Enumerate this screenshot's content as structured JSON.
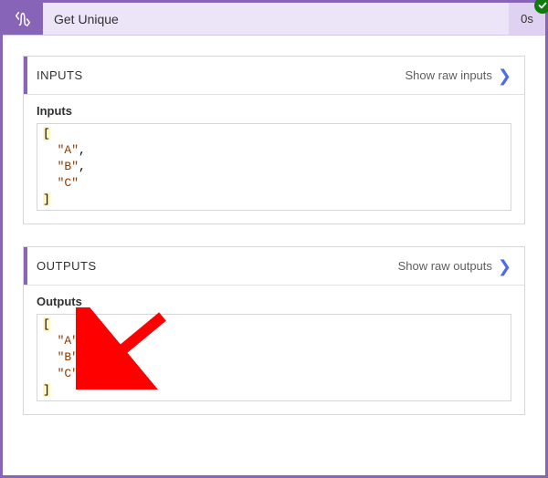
{
  "header": {
    "title": "Get Unique",
    "duration": "0s"
  },
  "inputs_card": {
    "heading": "INPUTS",
    "raw_link": "Show raw inputs",
    "sublabel": "Inputs"
  },
  "outputs_card": {
    "heading": "OUTPUTS",
    "raw_link": "Show raw outputs",
    "sublabel": "Outputs"
  },
  "code": {
    "open_bracket": "[",
    "close_bracket": "]",
    "indent": "  ",
    "inputs_values": [
      "\"A\"",
      "\"B\"",
      "\"C\""
    ],
    "outputs_values": [
      "\"A\"",
      "\"B\"",
      "\"C\""
    ]
  },
  "icons": {
    "compose": "compose-icon",
    "success": "success-check-icon",
    "chevron": "chevron-right-icon",
    "arrow": "arrow-annotation"
  }
}
